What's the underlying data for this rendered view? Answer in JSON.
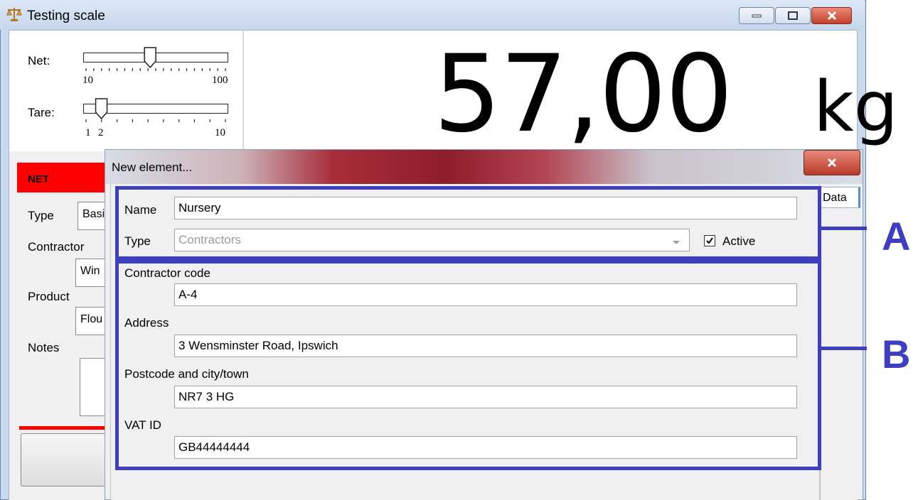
{
  "main_window": {
    "title": "Testing scale",
    "icon": "scale-icon"
  },
  "sliders": {
    "net": {
      "label": "Net:",
      "min_label": "10",
      "max_label": "100",
      "value_fraction": 0.46
    },
    "tare": {
      "label": "Tare:",
      "min_label": "1",
      "mid_label": "2",
      "max_label": "10",
      "value_fraction": 0.11
    }
  },
  "display": {
    "weight": "57,00",
    "unit": "kg"
  },
  "side_panel": {
    "status": "NET",
    "type_label": "Type",
    "type_value": "Basi",
    "contractor_label": "Contractor",
    "contractor_value": "Win",
    "product_label": "Product",
    "product_value": "Flou",
    "notes_label": "Notes"
  },
  "dialog": {
    "title": "New element...",
    "tab_label": "Data",
    "name_label": "Name",
    "name_value": "Nursery",
    "type_label": "Type",
    "type_value": "Contractors",
    "active_label": "Active",
    "active_checked": true,
    "contractor_code_label": "Contractor code",
    "contractor_code_value": "A-4",
    "address_label": "Address",
    "address_value": "3 Wensminster Road, Ipswich",
    "postcode_label": "Postcode and city/town",
    "postcode_value": "NR7 3 HG",
    "vat_label": "VAT ID",
    "vat_value": "GB44444444"
  },
  "callouts": {
    "a": "A",
    "b": "B"
  },
  "colors": {
    "callout": "#3d3fc0",
    "net_status": "#ff0000"
  }
}
